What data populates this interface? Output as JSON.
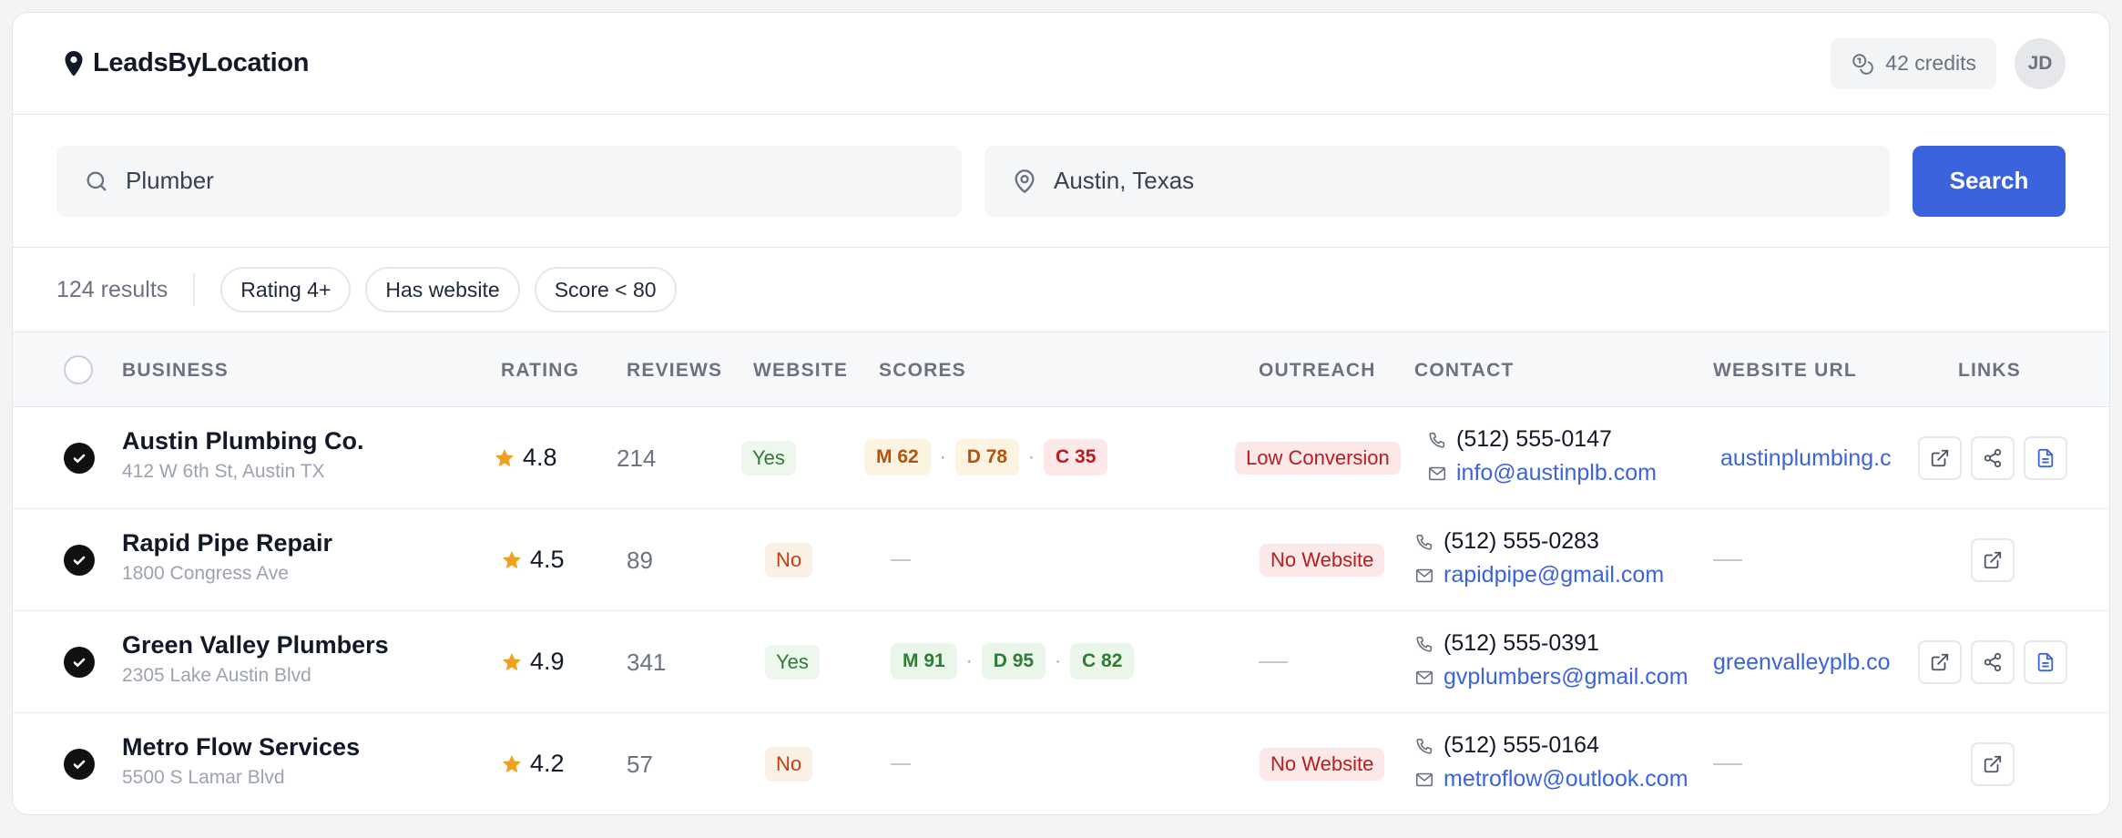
{
  "brand": {
    "name": "LeadsByLocation"
  },
  "header": {
    "credits": "42 credits",
    "avatar_initials": "JD"
  },
  "search": {
    "query": "Plumber",
    "location": "Austin, Texas",
    "button": "Search"
  },
  "filters": {
    "result_count": "124 results",
    "chips": [
      "Rating 4+",
      "Has website",
      "Score < 80"
    ]
  },
  "table": {
    "columns": [
      "BUSINESS",
      "RATING",
      "REVIEWS",
      "WEBSITE",
      "SCORES",
      "OUTREACH",
      "CONTACT",
      "WEBSITE URL",
      "LINKS"
    ],
    "rows": [
      {
        "name": "Austin Plumbing Co.",
        "address": "412 W 6th St, Austin TX",
        "rating": "4.8",
        "reviews": "214",
        "website": "Yes",
        "scores": [
          "M 62",
          "D 78",
          "C 35"
        ],
        "outreach": "Low Conversion",
        "phone": "(512) 555-0147",
        "email": "info@austinplb.com",
        "url": "austinplumbing.c"
      },
      {
        "name": "Rapid Pipe Repair",
        "address": "1800 Congress Ave",
        "rating": "4.5",
        "reviews": "89",
        "website": "No",
        "scores": [],
        "outreach": "No Website",
        "phone": "(512) 555-0283",
        "email": "rapidpipe@gmail.com",
        "url": ""
      },
      {
        "name": "Green Valley Plumbers",
        "address": "2305 Lake Austin Blvd",
        "rating": "4.9",
        "reviews": "341",
        "website": "Yes",
        "scores": [
          "M 91",
          "D 95",
          "C 82"
        ],
        "outreach": "",
        "phone": "(512) 555-0391",
        "email": "gvplumbers@gmail.com",
        "url": "greenvalleyplb.co"
      },
      {
        "name": "Metro Flow Services",
        "address": "5500 S Lamar Blvd",
        "rating": "4.2",
        "reviews": "57",
        "website": "No",
        "scores": [],
        "outreach": "No Website",
        "phone": "(512) 555-0164",
        "email": "metroflow@outlook.com",
        "url": ""
      }
    ]
  },
  "colors": {
    "accent": "#3b63dd",
    "star": "#f0a020",
    "danger_text": "#b91c1c",
    "success_text": "#2e7d32"
  }
}
